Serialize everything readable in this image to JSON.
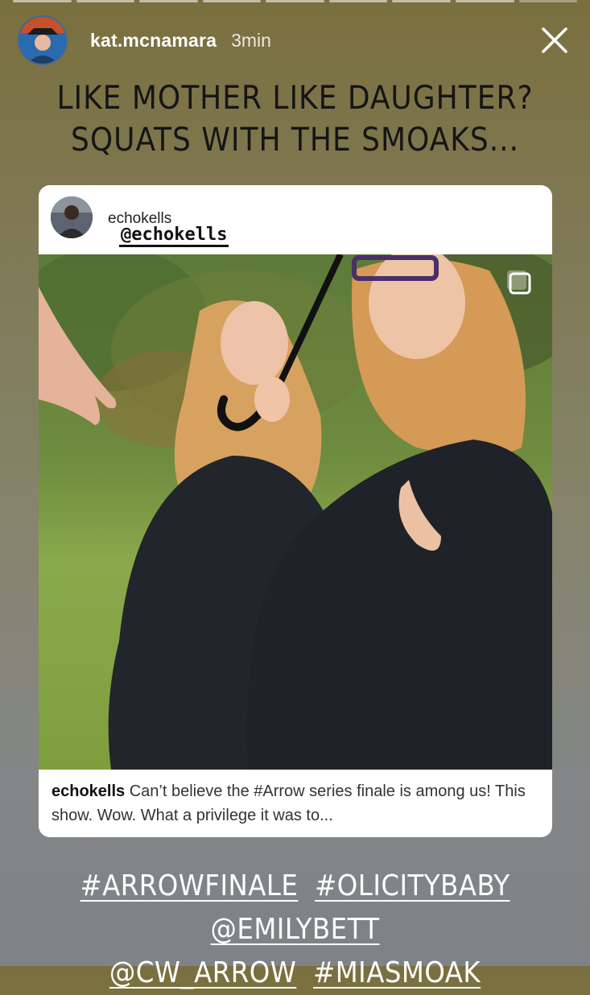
{
  "story": {
    "progress_segments": 9,
    "username": "kat.mcnamara",
    "time_ago": "3min"
  },
  "caption_top": {
    "line1": "LIKE MOTHER LIKE DAUGHTER?",
    "line2": "SQUATS WITH THE SMOAKS..."
  },
  "shared_post": {
    "username": "echokells",
    "mention_sticker": "@echokells",
    "caption_user": "echokells",
    "caption_text": "Can’t believe the #Arrow series finale is among us! This show. Wow. What a privilege it was to..."
  },
  "caption_bottom": {
    "tags_line1": [
      "#ARROWFINALE",
      "#OLICITYBABY",
      "@EMILYBETT"
    ],
    "tags_line2": [
      "@CW_ARROW",
      "#MIASMOAK"
    ]
  },
  "colors": {
    "background_top": "#7a6f3e",
    "background_bottom": "#7f8286",
    "card": "#ffffff"
  },
  "icons": [
    "close-icon",
    "carousel-icon"
  ]
}
